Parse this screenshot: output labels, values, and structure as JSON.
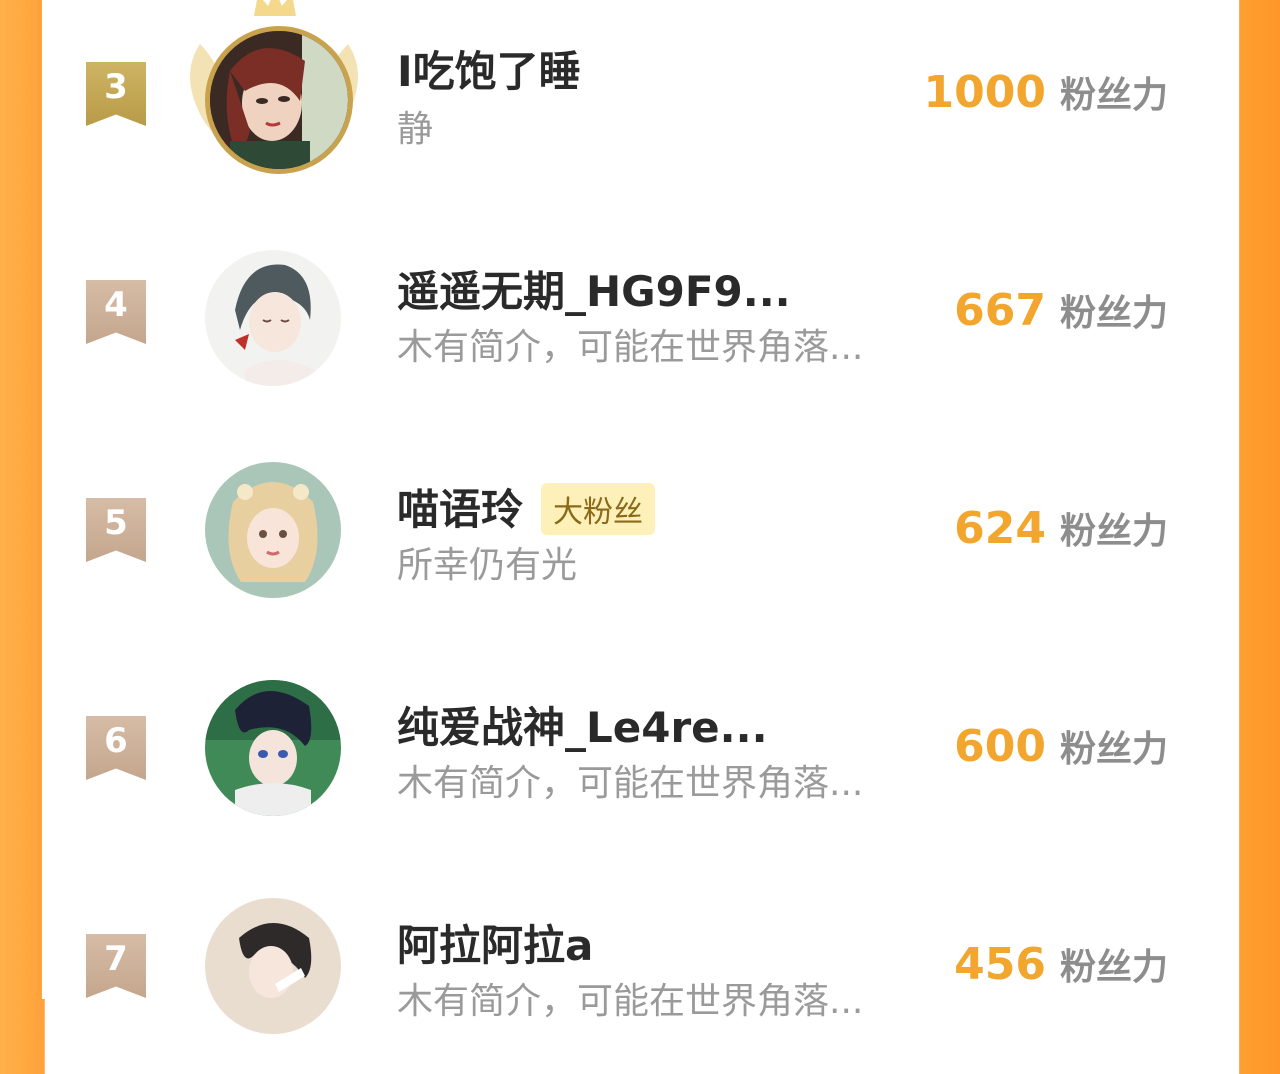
{
  "colors": {
    "side_stripe": "#ffa23a",
    "score_orange": "#f2a62e",
    "rank_gold": "#c2a555",
    "rank_bronze": "#cdb099",
    "fan_badge_bg": "#fdf0b8"
  },
  "unit_label": "粉丝力",
  "entries": [
    {
      "rank": "3",
      "name": "I吃饱了睡",
      "bio": "静",
      "score": "1000",
      "avatar_icon": "crowned-avatar-icon"
    },
    {
      "rank": "4",
      "name": "遥遥无期_HG9F9...",
      "bio": "木有简介，可能在世界角落...",
      "score": "667",
      "avatar_icon": "avatar-icon"
    },
    {
      "rank": "5",
      "name": "喵语玲",
      "badge": "大粉丝",
      "bio": "所幸仍有光",
      "score": "624",
      "avatar_icon": "avatar-icon"
    },
    {
      "rank": "6",
      "name": "纯爱战神_Le4re...",
      "bio": "木有简介，可能在世界角落...",
      "score": "600",
      "avatar_icon": "avatar-icon"
    },
    {
      "rank": "7",
      "name": "阿拉阿拉a",
      "bio": "木有简介，可能在世界角落...",
      "score": "456",
      "avatar_icon": "avatar-icon"
    }
  ]
}
